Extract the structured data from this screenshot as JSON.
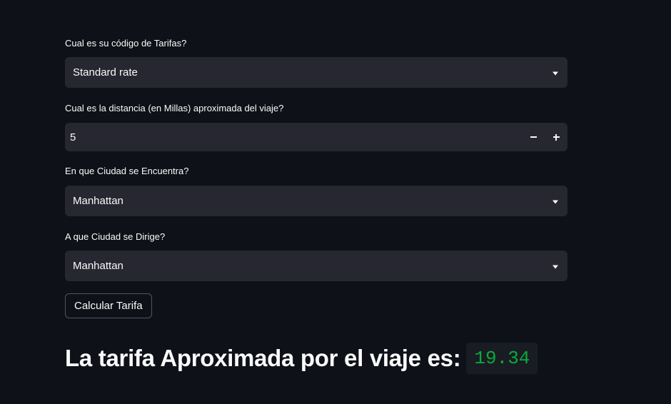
{
  "form": {
    "tariff": {
      "label": "Cual es su código de Tarifas?",
      "value": "Standard rate"
    },
    "distance": {
      "label": "Cual es la distancia (en Millas) aproximada del viaje?",
      "value": "5"
    },
    "origin": {
      "label": "En que Ciudad se Encuentra?",
      "value": "Manhattan"
    },
    "destination": {
      "label": "A que Ciudad se Dirige?",
      "value": "Manhattan"
    },
    "calculate_label": "Calcular Tarifa"
  },
  "result": {
    "heading": "La tarifa Aproximada por el viaje es:",
    "value": "19.34",
    "value_color": "#09ab3b"
  },
  "icons": {
    "select_caret": "chevron-down-icon",
    "decrement": "minus-icon",
    "increment": "plus-icon"
  }
}
